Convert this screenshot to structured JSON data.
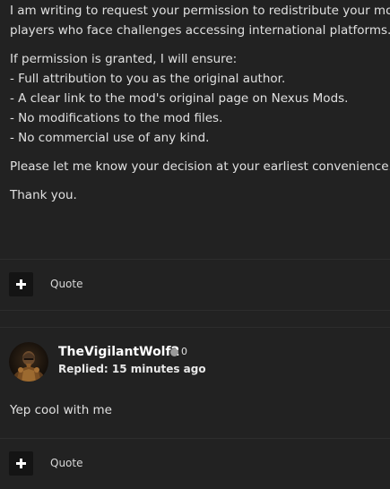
{
  "post1": {
    "paragraphs": [
      "I am writing to request your permission to redistribute your mod,",
      "players who face challenges accessing international platforms.",
      "If permission is granted, I will ensure:",
      "- Full attribution to you as the original author.",
      "- A clear link to the mod's original page on Nexus Mods.",
      "- No modifications to the mod files.",
      "- No commercial use of any kind.",
      "Please let me know your decision at your earliest convenience.",
      "Thank you."
    ],
    "actions": {
      "quote_label": "Quote",
      "add_icon": "plus-icon"
    }
  },
  "post2": {
    "author": {
      "username": "TheVigilantWolf2",
      "reputation": "0",
      "status_color": "#9a9a9a",
      "avatar_icon": "knight-avatar"
    },
    "meta": {
      "replied": "Replied: 15 minutes ago"
    },
    "body": "Yep cool with me",
    "actions": {
      "quote_label": "Quote",
      "add_icon": "plus-icon"
    }
  },
  "theme": {
    "background": "#222222",
    "divider": "#2d2d2d",
    "button_bg": "#141414",
    "text": "#e0e0e0"
  }
}
